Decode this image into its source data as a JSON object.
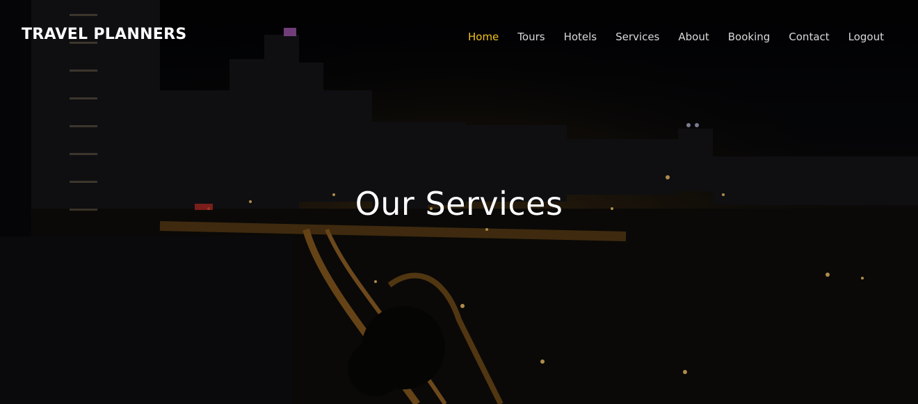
{
  "header": {
    "brand": "TRAVEL PLANNERS",
    "nav": [
      {
        "label": "Home",
        "active": true
      },
      {
        "label": "Tours",
        "active": false
      },
      {
        "label": "Hotels",
        "active": false
      },
      {
        "label": "Services",
        "active": false
      },
      {
        "label": "About",
        "active": false
      },
      {
        "label": "Booking",
        "active": false
      },
      {
        "label": "Contact",
        "active": false
      },
      {
        "label": "Logout",
        "active": false
      }
    ]
  },
  "hero": {
    "title": "Our Services",
    "background": "night-city-skyline-image"
  },
  "colors": {
    "nav_active": "#f2c21b",
    "nav_default": "#d9d9d9",
    "text": "#ffffff"
  }
}
